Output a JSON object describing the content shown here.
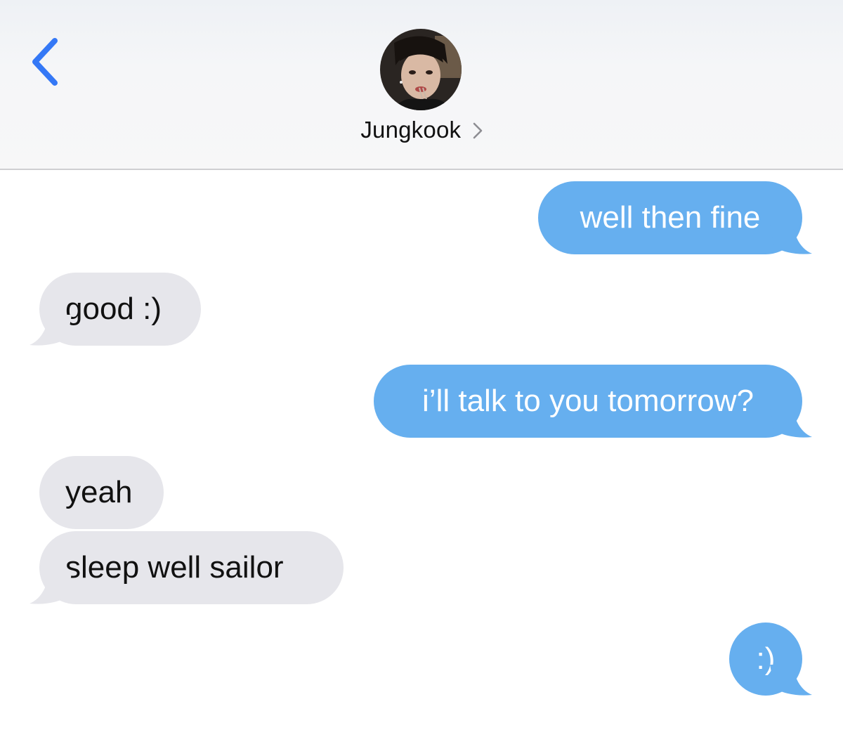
{
  "header": {
    "back_icon": "chevron-left-icon",
    "contact_name": "Jungkook",
    "contact_avatar": "contact-avatar-photo",
    "disclosure_icon": "chevron-right-icon",
    "accent_color": "#3478f6"
  },
  "messages": [
    {
      "direction": "sent",
      "text": "well then fine"
    },
    {
      "direction": "received",
      "text": "good :)"
    },
    {
      "direction": "sent",
      "text": "i’ll talk to you tomorrow?"
    },
    {
      "direction": "received",
      "text": "yeah"
    },
    {
      "direction": "received",
      "text": "sleep well sailor"
    },
    {
      "direction": "sent",
      "text": ":)"
    }
  ],
  "colors": {
    "sent_bubble": "#66afef",
    "received_bubble": "#e6e6eb",
    "sent_text": "#ffffff",
    "received_text": "#111111"
  }
}
